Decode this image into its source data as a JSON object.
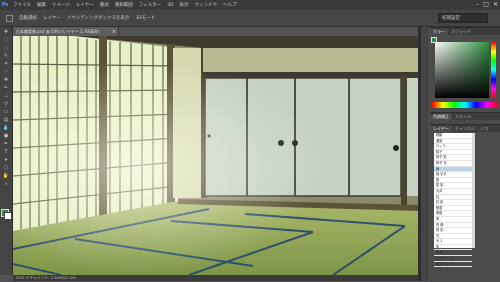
{
  "app": {
    "logo": "Ps"
  },
  "menu": [
    "ファイル",
    "編集",
    "イメージ",
    "レイヤー",
    "書式",
    "選択範囲",
    "フィルター",
    "3D",
    "表示",
    "ウィンドウ",
    "ヘルプ"
  ],
  "window_controls": [
    "–",
    "□",
    "✕"
  ],
  "options_bar": {
    "items": [
      "自動選択",
      "レイヤー",
      "バウンディングボックスを表示",
      "3Dモード"
    ],
    "workspace": "初期設定"
  },
  "document": {
    "tab_title": "日本間背景.psd @ 50% (レイヤー 1, RGB/8)",
    "close": "×",
    "status": "50%  ドキュメント: 2.64M/45.3M"
  },
  "panels": {
    "color": {
      "tabs": [
        "カラー",
        "スウォッチ"
      ],
      "fg_color": "#2f8f3f"
    },
    "adjust": {
      "tabs": [
        "色調補正",
        "スタイル"
      ]
    },
    "layers": {
      "tabs": [
        "レイヤー",
        "チャンネル",
        "パス"
      ],
      "rows": [
        "種類",
        "通常",
        "ロック:",
        "障子",
        "障子 影",
        "障子 光",
        "襖",
        "襖 引手",
        "壁",
        "壁 影",
        "天井",
        "柱",
        "柱 影",
        "鴨居",
        "敷居",
        "畳",
        "畳 縁",
        "畳 影",
        "光",
        "光 2",
        "床",
        "床 影",
        "レイヤー 1",
        "背景"
      ],
      "selected_index": 6
    }
  }
}
